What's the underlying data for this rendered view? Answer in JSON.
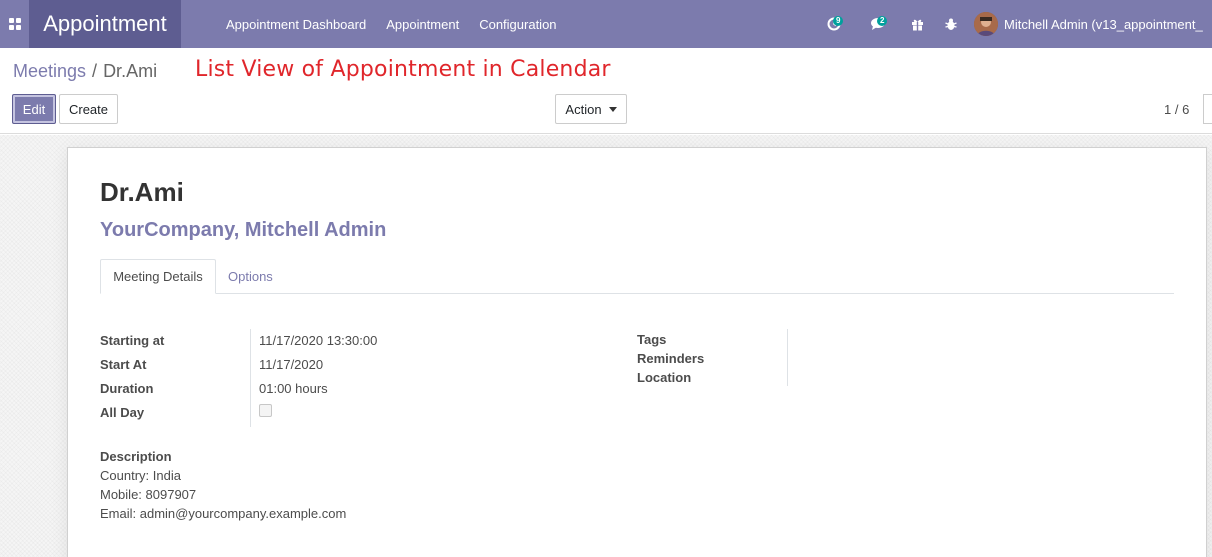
{
  "navbar": {
    "app_name": "Appointment",
    "menu": [
      "Appointment Dashboard",
      "Appointment",
      "Configuration"
    ],
    "activity_count": "9",
    "message_count": "2",
    "user_name": "Mitchell Admin (v13_appointment_"
  },
  "breadcrumb": {
    "parent": "Meetings",
    "separator": "/",
    "current": "Dr.Ami"
  },
  "annotation": "List View of Appointment in Calendar",
  "buttons": {
    "edit": "Edit",
    "create": "Create",
    "action": "Action"
  },
  "pager": "1 / 6",
  "record": {
    "title": "Dr.Ami",
    "subtitle": "YourCompany, Mitchell Admin"
  },
  "tabs": [
    "Meeting Details",
    "Options"
  ],
  "fields_left": [
    {
      "label": "Starting at",
      "value": "11/17/2020 13:30:00"
    },
    {
      "label": "Start At",
      "value": "11/17/2020"
    },
    {
      "label": "Duration",
      "value": "01:00 hours"
    },
    {
      "label": "All Day",
      "value": ""
    }
  ],
  "fields_right": [
    {
      "label": "Tags"
    },
    {
      "label": "Reminders"
    },
    {
      "label": "Location"
    }
  ],
  "description": {
    "label": "Description",
    "lines": [
      "Country: India",
      "Mobile: 8097907",
      "Email: admin@yourcompany.example.com"
    ]
  },
  "colors": {
    "navbar": "#7c7bad",
    "brand": "#5e5d91",
    "annotation": "#e0262b",
    "badge": "#00a09d"
  }
}
